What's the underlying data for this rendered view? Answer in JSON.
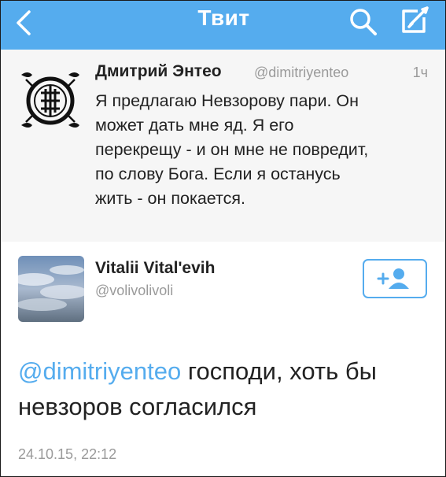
{
  "header": {
    "title": "Твит",
    "back_icon": "chevron-left-icon",
    "search_icon": "search-icon",
    "compose_icon": "compose-icon",
    "background_color": "#55acee"
  },
  "quoted_tweet": {
    "display_name": "Дмитрий Энтео",
    "handle": "@dimitriyenteo",
    "time": "1ч",
    "text": "Я предлагаю Невзорову пари. Он\nможет дать мне яд. Я его\nперекрещу - и он мне не повредит,\nпо слову Бога. Если я останусь\nжить - он покается."
  },
  "main_tweet": {
    "display_name": "Vitalii Vital'evih",
    "handle": "@volivolivoli",
    "follow_icon": "add-user-icon",
    "mention": "@dimitriyenteo",
    "text": " господи, хоть бы невзоров согласился",
    "timestamp": "24.10.15, 22:12"
  },
  "colors": {
    "accent": "#55acee",
    "muted_text": "#9a9a9a",
    "body_text": "#222222"
  }
}
